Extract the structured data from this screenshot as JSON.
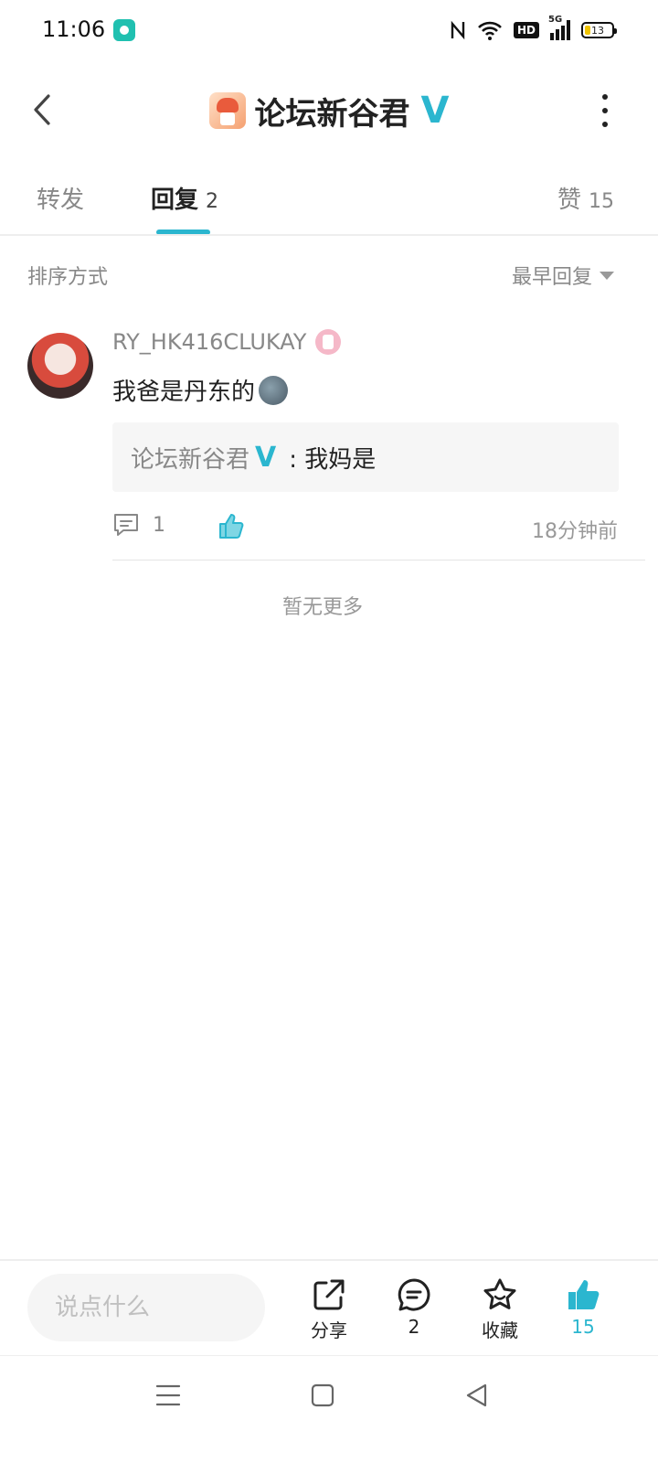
{
  "status_bar": {
    "time": "11:06",
    "network": "5G",
    "hd_label": "HD",
    "battery": "13"
  },
  "header": {
    "title": "论坛新谷君",
    "verified_mark": "V"
  },
  "tabs": {
    "forward": {
      "label": "转发"
    },
    "replies": {
      "label": "回复",
      "count": "2"
    },
    "likes": {
      "label": "赞",
      "count": "15"
    }
  },
  "sort": {
    "label": "排序方式",
    "selected": "最早回复"
  },
  "comment": {
    "username": "RY_HK416CLUKAY",
    "text": "我爸是丹东的",
    "quote": {
      "author": "论坛新谷君",
      "verified_mark": "V",
      "text": ": 我妈是"
    },
    "reply_count": "1",
    "time": "18分钟前"
  },
  "no_more_text": "暂无更多",
  "bottom_bar": {
    "input_placeholder": "说点什么",
    "share_label": "分享",
    "comment_count": "2",
    "favorite_label": "收藏",
    "like_count": "15"
  },
  "colors": {
    "accent": "#2bb6cf"
  }
}
